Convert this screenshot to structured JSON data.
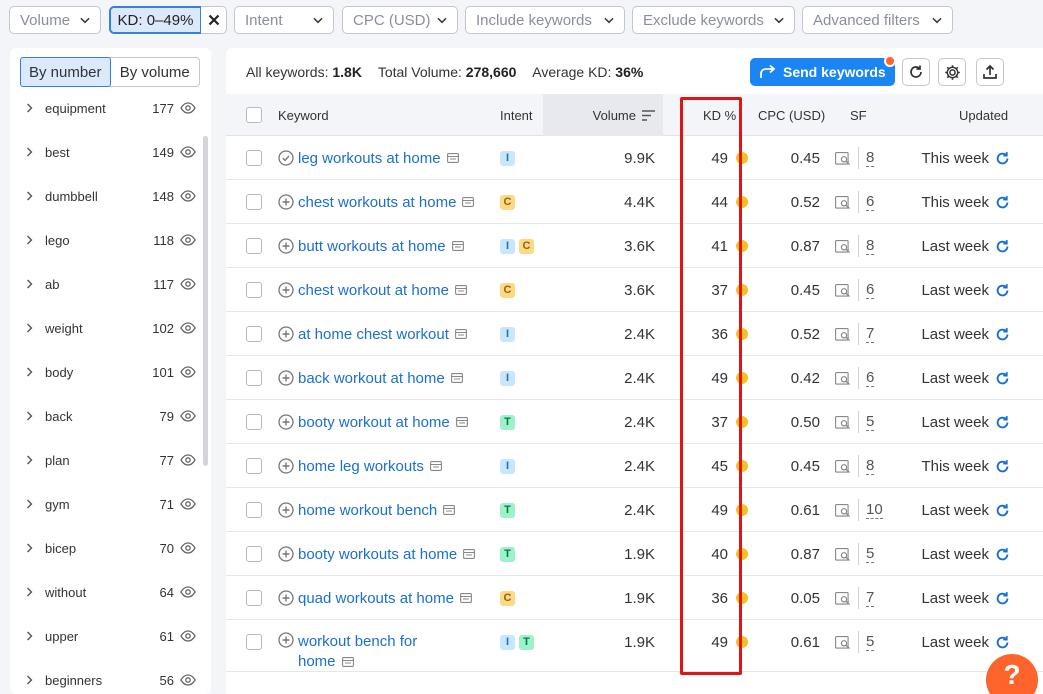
{
  "filters": {
    "volume": "Volume",
    "kd": "KD: 0–49%",
    "intent": "Intent",
    "cpc": "CPC (USD)",
    "include": "Include keywords",
    "exclude": "Exclude keywords",
    "advanced": "Advanced filters"
  },
  "groups": {
    "by_number": "By number",
    "by_volume": "By volume",
    "items": [
      {
        "name": "equipment",
        "count": "177"
      },
      {
        "name": "best",
        "count": "149"
      },
      {
        "name": "dumbbell",
        "count": "148"
      },
      {
        "name": "lego",
        "count": "118"
      },
      {
        "name": "ab",
        "count": "117"
      },
      {
        "name": "weight",
        "count": "102"
      },
      {
        "name": "body",
        "count": "101"
      },
      {
        "name": "back",
        "count": "79"
      },
      {
        "name": "plan",
        "count": "77"
      },
      {
        "name": "gym",
        "count": "71"
      },
      {
        "name": "bicep",
        "count": "70"
      },
      {
        "name": "without",
        "count": "64"
      },
      {
        "name": "upper",
        "count": "61"
      },
      {
        "name": "beginners",
        "count": "56"
      }
    ]
  },
  "stats": {
    "all_keywords_label": "All keywords:",
    "all_keywords_value": "1.8K",
    "total_volume_label": "Total Volume:",
    "total_volume_value": "278,660",
    "avg_kd_label": "Average KD:",
    "avg_kd_value": "36%"
  },
  "toolbar": {
    "send_label": "Send keywords"
  },
  "table": {
    "headers": {
      "keyword": "Keyword",
      "intent": "Intent",
      "volume": "Volume",
      "kd": "KD %",
      "cpc": "CPC (USD)",
      "sf": "SF",
      "updated": "Updated"
    },
    "rows": [
      {
        "kw1": "leg workouts at home",
        "kw2": "",
        "added": true,
        "intent": [
          "I"
        ],
        "volume": "9.9K",
        "kd": "49",
        "cpc": "0.45",
        "sf": "8",
        "updated": "This week"
      },
      {
        "kw1": "chest workouts at home",
        "kw2": "",
        "added": false,
        "intent": [
          "C"
        ],
        "volume": "4.4K",
        "kd": "44",
        "cpc": "0.52",
        "sf": "6",
        "updated": "This week"
      },
      {
        "kw1": "butt workouts at home",
        "kw2": "",
        "added": false,
        "intent": [
          "I",
          "C"
        ],
        "volume": "3.6K",
        "kd": "41",
        "cpc": "0.87",
        "sf": "8",
        "updated": "Last week"
      },
      {
        "kw1": "chest workout at home",
        "kw2": "",
        "added": false,
        "intent": [
          "C"
        ],
        "volume": "3.6K",
        "kd": "37",
        "cpc": "0.45",
        "sf": "6",
        "updated": "Last week"
      },
      {
        "kw1": "at home chest workout",
        "kw2": "",
        "added": false,
        "intent": [
          "I"
        ],
        "volume": "2.4K",
        "kd": "36",
        "cpc": "0.52",
        "sf": "7",
        "updated": "Last week"
      },
      {
        "kw1": "back workout at home",
        "kw2": "",
        "added": false,
        "intent": [
          "I"
        ],
        "volume": "2.4K",
        "kd": "49",
        "cpc": "0.42",
        "sf": "6",
        "updated": "Last week"
      },
      {
        "kw1": "booty workout at home",
        "kw2": "",
        "added": false,
        "intent": [
          "T"
        ],
        "volume": "2.4K",
        "kd": "37",
        "cpc": "0.50",
        "sf": "5",
        "updated": "Last week"
      },
      {
        "kw1": "home leg workouts",
        "kw2": "",
        "added": false,
        "intent": [
          "I"
        ],
        "volume": "2.4K",
        "kd": "45",
        "cpc": "0.45",
        "sf": "8",
        "updated": "This week"
      },
      {
        "kw1": "home workout bench",
        "kw2": "",
        "added": false,
        "intent": [
          "T"
        ],
        "volume": "2.4K",
        "kd": "49",
        "cpc": "0.61",
        "sf": "10",
        "updated": "Last week"
      },
      {
        "kw1": "booty workouts at home",
        "kw2": "",
        "added": false,
        "intent": [
          "T"
        ],
        "volume": "1.9K",
        "kd": "40",
        "cpc": "0.87",
        "sf": "5",
        "updated": "Last week"
      },
      {
        "kw1": "quad workouts at home",
        "kw2": "",
        "added": false,
        "intent": [
          "C"
        ],
        "volume": "1.9K",
        "kd": "36",
        "cpc": "0.05",
        "sf": "7",
        "updated": "Last week"
      },
      {
        "kw1": "workout bench for",
        "kw2": "home",
        "added": false,
        "intent": [
          "I",
          "T"
        ],
        "volume": "1.9K",
        "kd": "49",
        "cpc": "0.61",
        "sf": "5",
        "updated": "Last week"
      }
    ]
  },
  "help_label": "?",
  "colors": {
    "accent": "#1c85f5",
    "link": "#1a6fd1",
    "kd_dot": "#f7c022",
    "highlight_box": "#e01414",
    "help_button": "#ff642d"
  },
  "icons": {
    "filter_chevron": "chevron-down-icon",
    "clear": "close-icon",
    "group_expand": "chevron-right-icon",
    "group_visibility": "eye-icon",
    "send": "share-arrow-icon",
    "refresh": "refresh-icon",
    "settings": "gear-icon",
    "export": "export-icon",
    "add_keyword": "plus-circle-icon",
    "added_keyword": "check-circle-icon",
    "serp": "serp-icon",
    "sort": "sort-icon",
    "sf": "sf-search-icon",
    "updated": "refresh-icon"
  }
}
